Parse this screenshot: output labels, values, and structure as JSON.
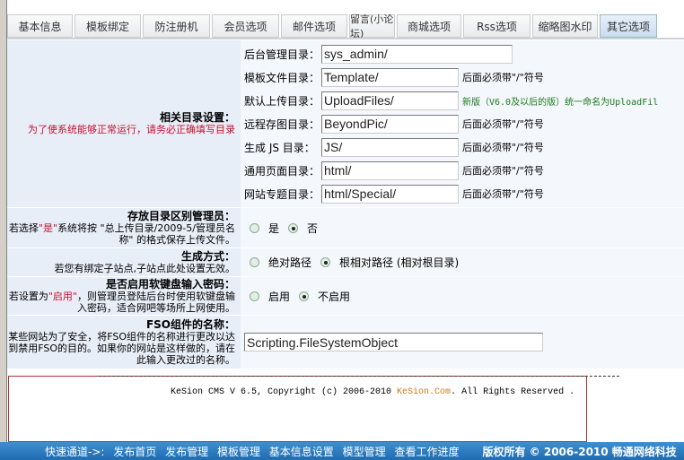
{
  "tabs": [
    "基本信息",
    "模板绑定",
    "防注册机",
    "会员选项",
    "邮件选项",
    "留言(小论坛)",
    "商城选项",
    "Rss选项",
    "缩略图水印",
    "其它选项"
  ],
  "active_tab": 9,
  "dirs": {
    "title": "相关目录设置：",
    "note": "为了使系统能够正常运行，请务必正确填写目录",
    "fields": [
      {
        "label": "后台管理目录：",
        "value": "sys_admin/",
        "hint": ""
      },
      {
        "label": "模板文件目录：",
        "value": "Template/",
        "hint": "后面必须带\"/\"符号"
      },
      {
        "label": "默认上传目录：",
        "value": "UploadFiles/",
        "hint": "新版（V6.0及以后的版）统一命名为UploadFil"
      },
      {
        "label": "远程存图目录：",
        "value": "BeyondPic/",
        "hint": "后面必须带\"/\"符号"
      },
      {
        "label": "生成 JS 目录：",
        "value": "JS/",
        "hint": "后面必须带\"/\"符号"
      },
      {
        "label": "通用页面目录：",
        "value": "html/",
        "hint": "后面必须带\"/\"符号"
      },
      {
        "label": "网站专题目录：",
        "value": "html/Special/",
        "hint": "后面必须带\"/\"符号"
      }
    ]
  },
  "admin_dir": {
    "title": "存放目录区别管理员：",
    "d1": "若选择",
    "d2": "\"是\"",
    "d3": "系统将按 \"总上传目录/2009-5/管理员名称\" 的格式保存上传文件。",
    "opts": [
      "是",
      "否"
    ],
    "selected": 1
  },
  "gen": {
    "title": "生成方式：",
    "desc": "若您有绑定子站点,子站点此处设置无效。",
    "opts": [
      "绝对路径",
      "根相对路径 (相对根目录)"
    ],
    "selected": 1
  },
  "softkb": {
    "title": "是否启用软键盘输入密码：",
    "d1": "若设置为",
    "d2": "\"启用\"",
    "d3": "，则管理员登陆后台时使用软键盘输入密码，适合网吧等场所上网使用。",
    "opts": [
      "启用",
      "不启用"
    ],
    "selected": 1
  },
  "fso": {
    "title": "FSO组件的名称：",
    "desc": "某些网站为了安全，将FSO组件的名称进行更改以达到禁用FSO的目的。如果你的网站是这样做的，请在此输入更改过的名称。",
    "value": "Scripting.FileSystemObject"
  },
  "footer": {
    "pre": "KeSion CMS V 6.5, Copyright (c) 2006-2010 ",
    "brand": "KeSion.Com",
    "post": ". All Rights Reserved ."
  },
  "bottom": {
    "quick": "快速通道->:",
    "links": [
      "发布首页",
      "发布管理",
      "模板管理",
      "基本信息设置",
      "模型管理",
      "查看工作进度"
    ],
    "copyright": "版权所有 © 2006-2010 畅通网络科技"
  }
}
